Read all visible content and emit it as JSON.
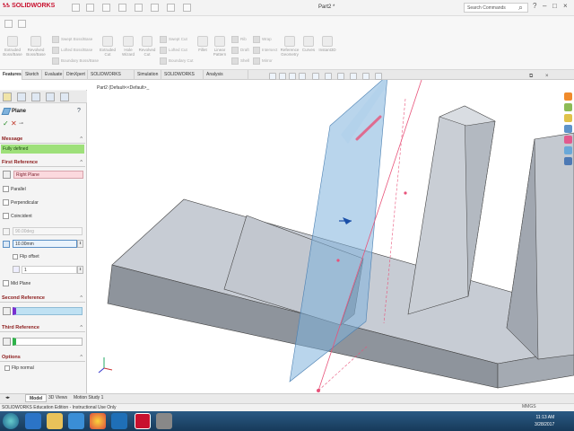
{
  "app": {
    "logo_text": "SOLIDWORKS",
    "document_title": "Part2 *",
    "search_placeholder": "Search Commands"
  },
  "command_manager": {
    "large": [
      {
        "label": "Extruded Boss/Base"
      },
      {
        "label": "Revolved Boss/Base"
      },
      {
        "label": "Extruded Cut"
      },
      {
        "label": "Hole Wizard"
      },
      {
        "label": "Revolved Cut"
      },
      {
        "label": "Fillet"
      },
      {
        "label": "Linear Pattern"
      },
      {
        "label": "Reference Geometry"
      },
      {
        "label": "Curves"
      },
      {
        "label": "Instant3D"
      }
    ],
    "small": [
      {
        "label": "Swept Boss/Base"
      },
      {
        "label": "Lofted Boss/Base"
      },
      {
        "label": "Boundary Boss/Base"
      },
      {
        "label": "Swept Cut"
      },
      {
        "label": "Lofted Cut"
      },
      {
        "label": "Boundary Cut"
      },
      {
        "label": "Rib"
      },
      {
        "label": "Draft"
      },
      {
        "label": "Shell"
      },
      {
        "label": "Wrap"
      },
      {
        "label": "Intersect"
      },
      {
        "label": "Mirror"
      }
    ]
  },
  "tabs": [
    {
      "label": "Features"
    },
    {
      "label": "Sketch"
    },
    {
      "label": "Evaluate"
    },
    {
      "label": "DimXpert"
    },
    {
      "label": "SOLIDWORKS Add-Ins"
    },
    {
      "label": "Simulation"
    },
    {
      "label": "SOLIDWORKS MBD"
    },
    {
      "label": "Analysis Preparation"
    }
  ],
  "tree_root": "Part2 (Default<<Default>_",
  "property_manager": {
    "title": "Plane",
    "message_header": "Message",
    "message_text": "Fully defined",
    "first_ref_header": "First Reference",
    "first_ref_value": "Right Plane",
    "options": [
      "Parallel",
      "Perpendicular",
      "Coincident"
    ],
    "angle_value": "90.00deg",
    "distance_value": "10.00mm",
    "flip_offset": "Flip offset",
    "count_value": "1",
    "mid_plane": "Mid Plane",
    "second_ref_header": "Second Reference",
    "third_ref_header": "Third Reference",
    "options_header": "Options",
    "flip_normal": "Flip normal"
  },
  "bottom_tabs": [
    {
      "label": "Model"
    },
    {
      "label": "3D Views"
    },
    {
      "label": "Motion Study 1"
    }
  ],
  "status": {
    "text": "SOLIDWORKS Education Edition - Instructional Use Only",
    "units": "MMGS"
  },
  "clock": {
    "time": "11:13 AM",
    "date": "3/28/2017"
  },
  "colors": {
    "message_green": "#9ee07a",
    "plane_blue": "#7fb2dc",
    "selection_pink": "#e8537a",
    "solidworks_red": "#c8102e"
  }
}
